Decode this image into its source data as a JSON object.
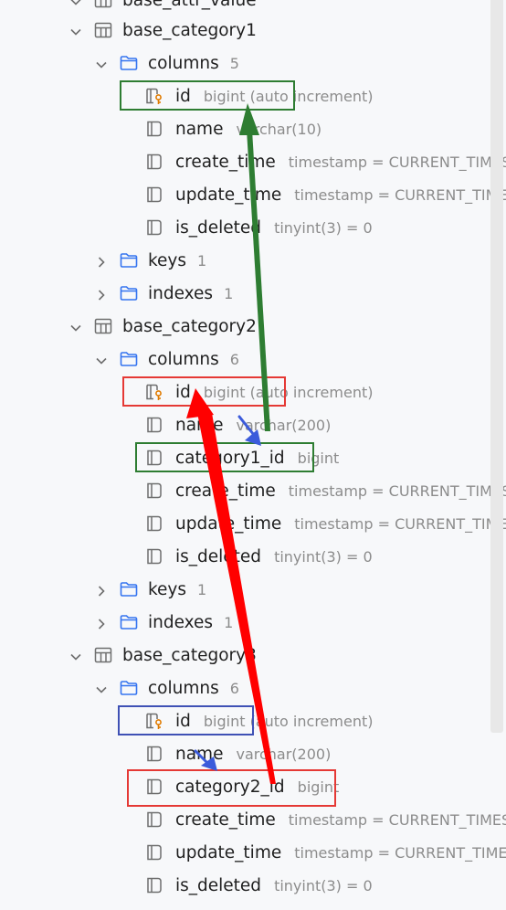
{
  "tree": {
    "tables": [
      {
        "name": "base_category1",
        "folders": [
          {
            "label": "columns",
            "count": "5",
            "expanded": true,
            "columns": [
              {
                "name": "id",
                "type": "bigint (auto increment)",
                "key": true
              },
              {
                "name": "name",
                "type": "varchar(10)"
              },
              {
                "name": "create_time",
                "type": "timestamp = CURRENT_TIMESTAMP"
              },
              {
                "name": "update_time",
                "type": "timestamp = CURRENT_TIMESTAMP"
              },
              {
                "name": "is_deleted",
                "type": "tinyint(3) = 0"
              }
            ]
          },
          {
            "label": "keys",
            "count": "1",
            "expanded": false
          },
          {
            "label": "indexes",
            "count": "1",
            "expanded": false
          }
        ]
      },
      {
        "name": "base_category2",
        "folders": [
          {
            "label": "columns",
            "count": "6",
            "expanded": true,
            "columns": [
              {
                "name": "id",
                "type": "bigint (auto increment)",
                "key": true
              },
              {
                "name": "name",
                "type": "varchar(200)"
              },
              {
                "name": "category1_id",
                "type": "bigint"
              },
              {
                "name": "create_time",
                "type": "timestamp = CURRENT_TIMESTAMP"
              },
              {
                "name": "update_time",
                "type": "timestamp = CURRENT_TIMESTAMP"
              },
              {
                "name": "is_deleted",
                "type": "tinyint(3) = 0"
              }
            ]
          },
          {
            "label": "keys",
            "count": "1",
            "expanded": false
          },
          {
            "label": "indexes",
            "count": "1",
            "expanded": false
          }
        ]
      },
      {
        "name": "base_category3",
        "folders": [
          {
            "label": "columns",
            "count": "6",
            "expanded": true,
            "columns": [
              {
                "name": "id",
                "type": "bigint (auto increment)",
                "key": true
              },
              {
                "name": "name",
                "type": "varchar(200)"
              },
              {
                "name": "category2_id",
                "type": "bigint"
              },
              {
                "name": "create_time",
                "type": "timestamp = CURRENT_TIMESTAMP"
              },
              {
                "name": "update_time",
                "type": "timestamp = CURRENT_TIMESTAMP"
              },
              {
                "name": "is_deleted",
                "type": "tinyint(3) = 0"
              }
            ]
          }
        ]
      }
    ],
    "top_partial_label": "base_attr_value"
  },
  "colors": {
    "folder_icon": "#3574f0",
    "key_icon": "#e07b00",
    "muted_text": "#8c8c8c",
    "green_highlight": "#2e7d32",
    "red_highlight": "#e53935",
    "blue_highlight": "#3f51b5",
    "red_arrow": "#ff0000",
    "green_arrow": "#2e7d32",
    "blue_arrow": "#3b5bdb"
  }
}
